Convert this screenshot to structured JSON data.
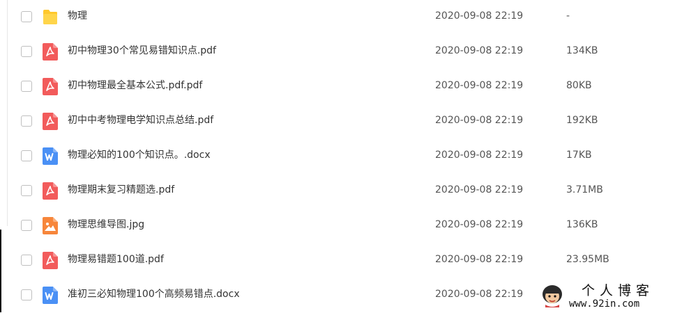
{
  "files": [
    {
      "name": "物理",
      "date": "2020-09-08 22:19",
      "size": "-",
      "type": "folder"
    },
    {
      "name": "初中物理30个常见易错知识点.pdf",
      "date": "2020-09-08 22:19",
      "size": "134KB",
      "type": "pdf"
    },
    {
      "name": "初中物理最全基本公式.pdf.pdf",
      "date": "2020-09-08 22:19",
      "size": "80KB",
      "type": "pdf"
    },
    {
      "name": "初中中考物理电学知识点总结.pdf",
      "date": "2020-09-08 22:19",
      "size": "192KB",
      "type": "pdf"
    },
    {
      "name": "物理必知的100个知识点。.docx",
      "date": "2020-09-08 22:19",
      "size": "17KB",
      "type": "word"
    },
    {
      "name": "物理期末复习精题选.pdf",
      "date": "2020-09-08 22:19",
      "size": "3.71MB",
      "type": "pdf"
    },
    {
      "name": "物理思维导图.jpg",
      "date": "2020-09-08 22:19",
      "size": "136KB",
      "type": "image"
    },
    {
      "name": "物理易错题100道.pdf",
      "date": "2020-09-08 22:19",
      "size": "23.95MB",
      "type": "pdf"
    },
    {
      "name": "准初三必知物理100个高频易错点.docx",
      "date": "2020-09-08 22:19",
      "size": "",
      "type": "word"
    }
  ],
  "icons": {
    "folder": {
      "name": "folder-icon",
      "color": "#FFC82C"
    },
    "pdf": {
      "name": "pdf-file-icon",
      "color": "#F25B5B"
    },
    "word": {
      "name": "word-file-icon",
      "color": "#4A90F5"
    },
    "image": {
      "name": "image-file-icon",
      "color": "#F7863B"
    }
  },
  "watermark": {
    "title": "个人博客",
    "url": "www.92in.com"
  }
}
